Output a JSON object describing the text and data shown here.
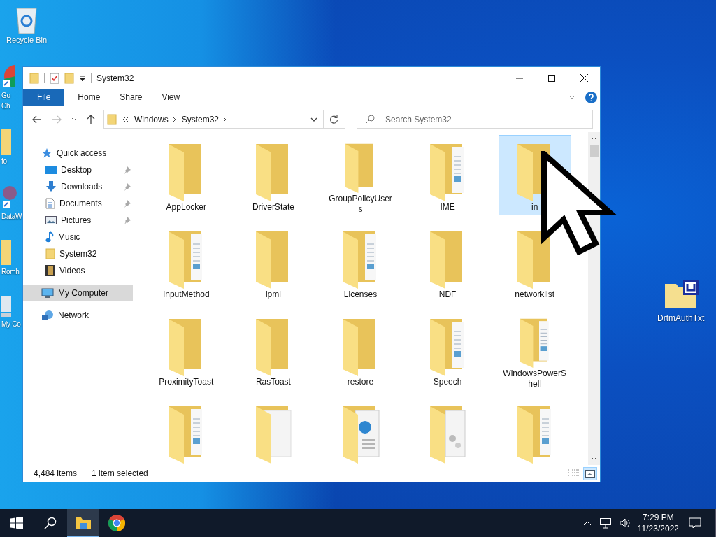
{
  "desktop_icons": [
    {
      "kind": "recycle",
      "lines": [
        "Recycle Bin"
      ]
    },
    {
      "kind": "chrome",
      "lines": [
        "Go",
        "Ch"
      ]
    },
    {
      "kind": "folder",
      "lines": [
        "fo"
      ]
    },
    {
      "kind": "app",
      "lines": [
        "DataW"
      ]
    },
    {
      "kind": "folder",
      "lines": [
        "Romh"
      ]
    },
    {
      "kind": "computer",
      "lines": [
        "My Co"
      ]
    }
  ],
  "desktop_right_icon": {
    "label": "DrtmAuthTxt"
  },
  "window": {
    "title": "System32",
    "ribbon_tabs": [
      {
        "label": "File",
        "selected": true
      },
      {
        "label": "Home",
        "selected": false
      },
      {
        "label": "Share",
        "selected": false
      },
      {
        "label": "View",
        "selected": false
      }
    ],
    "breadcrumb": [
      "Windows",
      "System32"
    ],
    "search": {
      "placeholder": "Search System32"
    },
    "nav": [
      {
        "label": "Quick access",
        "kind": "star",
        "selected": false,
        "children": [
          {
            "label": "Desktop",
            "kind": "desktop",
            "pinned": true,
            "selected": false
          },
          {
            "label": "Downloads",
            "kind": "download",
            "pinned": true,
            "selected": false
          },
          {
            "label": "Documents",
            "kind": "document",
            "pinned": true,
            "selected": false
          },
          {
            "label": "Pictures",
            "kind": "picture",
            "pinned": true,
            "selected": false
          },
          {
            "label": "Music",
            "kind": "music",
            "pinned": false,
            "selected": false
          },
          {
            "label": "System32",
            "kind": "folder",
            "pinned": false,
            "selected": false
          },
          {
            "label": "Videos",
            "kind": "video",
            "pinned": false,
            "selected": false
          }
        ]
      },
      {
        "label": "My Computer",
        "kind": "computer",
        "selected": true
      },
      {
        "label": "Network",
        "kind": "network",
        "selected": false
      }
    ],
    "items": [
      {
        "name": "AppLocker",
        "kind": "plain",
        "selected": false
      },
      {
        "name": "DriverState",
        "kind": "plain",
        "selected": false
      },
      {
        "name": "GroupPolicyUsers",
        "kind": "plain",
        "selected": false
      },
      {
        "name": "IME",
        "kind": "docs",
        "selected": false
      },
      {
        "name": "in",
        "kind": "plain",
        "selected": true
      },
      {
        "name": "InputMethod",
        "kind": "docs",
        "selected": false
      },
      {
        "name": "lpmi",
        "kind": "plain",
        "selected": false
      },
      {
        "name": "Licenses",
        "kind": "docs",
        "selected": false
      },
      {
        "name": "NDF",
        "kind": "plain",
        "selected": false
      },
      {
        "name": "networklist",
        "kind": "plain",
        "selected": false
      },
      {
        "name": "ProximityToast",
        "kind": "plain",
        "selected": false
      },
      {
        "name": "RasToast",
        "kind": "plain",
        "selected": false
      },
      {
        "name": "restore",
        "kind": "plain",
        "selected": false
      },
      {
        "name": "Speech",
        "kind": "docs",
        "selected": false
      },
      {
        "name": "WindowsPowerShell",
        "kind": "docs",
        "selected": false
      },
      {
        "kind": "docs",
        "selected": false
      },
      {
        "kind": "page",
        "selected": false
      },
      {
        "kind": "web",
        "selected": false
      },
      {
        "kind": "gears",
        "selected": false
      },
      {
        "kind": "docs",
        "selected": false
      }
    ],
    "status": {
      "count": "4,484 items",
      "selection": "1 item selected"
    }
  },
  "taskbar": {
    "apps": [
      {
        "kind": "explorer",
        "active": true
      },
      {
        "kind": "chrome",
        "active": false
      }
    ],
    "time": "7:29 PM",
    "date": "11/23/2022"
  }
}
